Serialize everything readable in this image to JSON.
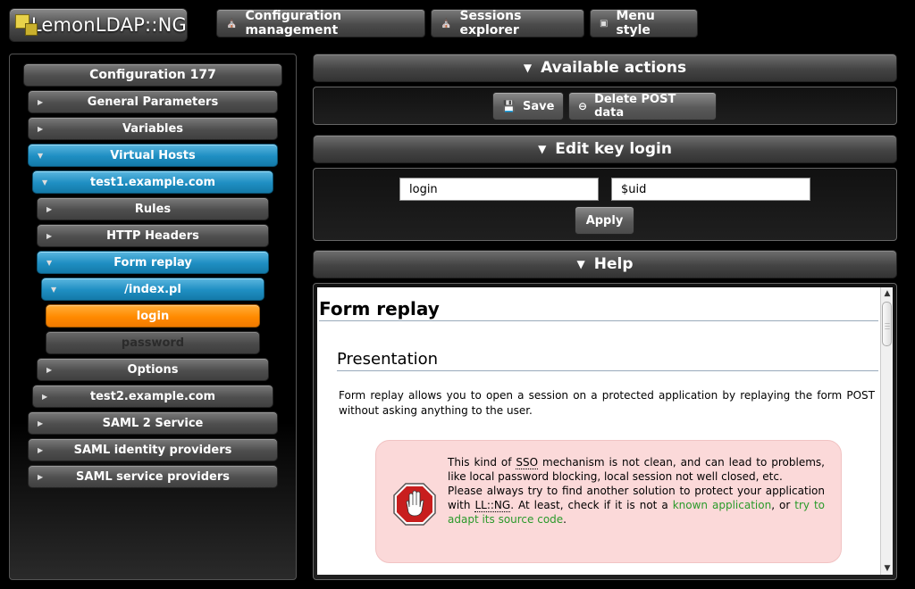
{
  "logo": {
    "text": "LemonLDAP::NG"
  },
  "topnav": {
    "config_management": "Configuration management",
    "sessions_explorer": "Sessions explorer",
    "menu_style": "Menu style"
  },
  "tree": {
    "header": "Configuration 177",
    "items": [
      {
        "label": "General Parameters"
      },
      {
        "label": "Variables"
      },
      {
        "label": "Virtual Hosts"
      },
      {
        "label": "test1.example.com"
      },
      {
        "label": "Rules"
      },
      {
        "label": "HTTP Headers"
      },
      {
        "label": "Form replay"
      },
      {
        "label": "/index.pl"
      },
      {
        "label": "login"
      },
      {
        "label": "password"
      },
      {
        "label": "Options"
      },
      {
        "label": "test2.example.com"
      },
      {
        "label": "SAML 2 Service"
      },
      {
        "label": "SAML identity providers"
      },
      {
        "label": "SAML service providers"
      }
    ]
  },
  "actions": {
    "title": "Available actions",
    "save": "Save",
    "delete_post": "Delete POST data"
  },
  "edit": {
    "title": "Edit key login",
    "key_value": "login",
    "val_value": "$uid",
    "apply": "Apply"
  },
  "help": {
    "title": "Help",
    "h1": "Form replay",
    "h2": "Presentation",
    "paragraph": "Form replay allows you to open a session on a protected application by replaying the form POST without asking anything to the user.",
    "warn": {
      "t1": "This kind of ",
      "sso": "SSO",
      "t2": " mechanism is not clean, and can lead to problems, like local password blocking, local session not well closed, etc.",
      "t3": "Please always try to find another solution to protect your application with ",
      "llng": "LL::NG",
      "t4": ". At least, check if it is not a ",
      "link1": "known application",
      "t5": ", or ",
      "link2": "try to adapt its source code",
      "t6": "."
    }
  },
  "colors": {
    "blue_active": "#1e8ec2",
    "orange_selected": "#ff8a00",
    "link_green": "#2a9a2a",
    "warn_bg": "#fbd9d9"
  }
}
